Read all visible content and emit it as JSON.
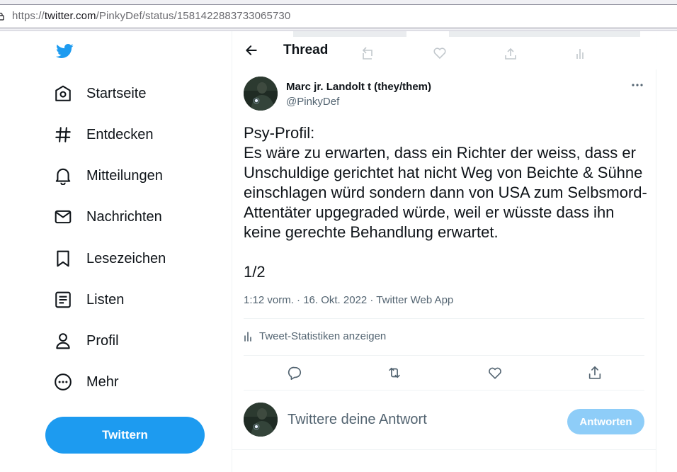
{
  "browser": {
    "url_prefix": "https://",
    "url_host": "twitter.com",
    "url_path": "/PinkyDef/status/1581422883733065730"
  },
  "sidebar": {
    "items": [
      {
        "label": "Startseite",
        "icon": "home-icon"
      },
      {
        "label": "Entdecken",
        "icon": "hashtag-icon"
      },
      {
        "label": "Mitteilungen",
        "icon": "bell-icon"
      },
      {
        "label": "Nachrichten",
        "icon": "mail-icon"
      },
      {
        "label": "Lesezeichen",
        "icon": "bookmark-icon"
      },
      {
        "label": "Listen",
        "icon": "list-icon"
      },
      {
        "label": "Profil",
        "icon": "person-icon"
      },
      {
        "label": "Mehr",
        "icon": "more-circle-icon"
      }
    ],
    "tweet_button": "Twittern"
  },
  "header": {
    "title": "Thread"
  },
  "tweet": {
    "author_name": "Marc jr. Landolt t (they/them)",
    "author_handle": "@PinkyDef",
    "text": "Psy-Profil:\nEs wäre zu erwarten, dass ein Richter der weiss, dass er Unschuldige gerichtet hat nicht Weg von Beichte & Sühne einschlagen würd sondern dann von USA zum Selbsmord-Attentäter upgegraded würde, weil er wüsste dass ihn keine gerechte Behandlung erwartet.\n\n1/2",
    "meta": "1:12 vorm. · 16. Okt. 2022 · Twitter Web App",
    "stats_label": "Tweet-Statistiken anzeigen"
  },
  "reply": {
    "placeholder": "Twittere deine Antwort",
    "button": "Antworten"
  },
  "colors": {
    "accent": "#1d9bf0",
    "accent_disabled": "#8ecdf8",
    "text": "#0f1419",
    "secondary": "#536471"
  }
}
